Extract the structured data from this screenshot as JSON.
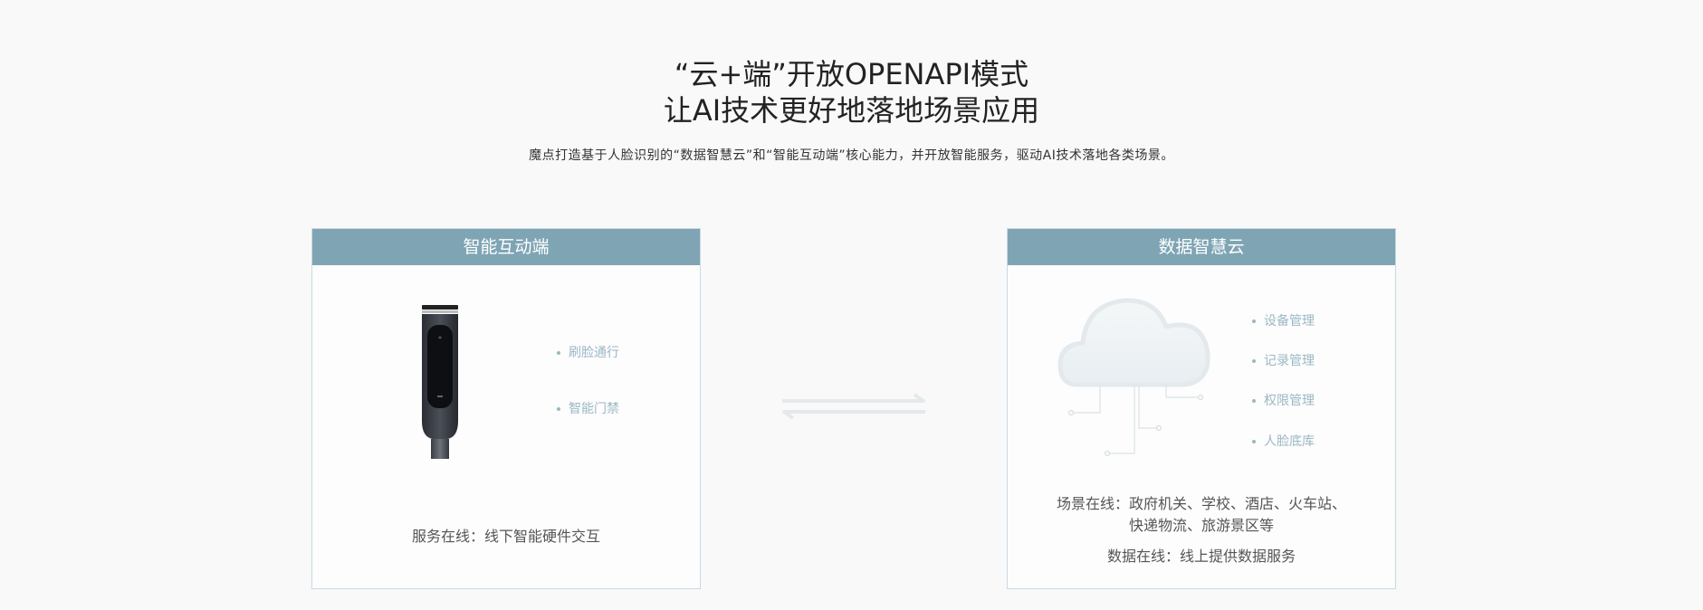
{
  "hero": {
    "title_line1": "“云+端”开放OPENAPI模式",
    "title_line2": "让AI技术更好地落地场景应用",
    "subtitle": "魔点打造基于人脸识别的“数据智慧云”和“智能互动端”核心能力，并开放智能服务，驱动AI技术落地各类场景。"
  },
  "left_panel": {
    "title": "智能互动端",
    "features": [
      "刷脸通行",
      "智能门禁"
    ],
    "caption": "服务在线：线下智能硬件交互"
  },
  "right_panel": {
    "title": "数据智慧云",
    "features": [
      "设备管理",
      "记录管理",
      "权限管理",
      "人脸底库"
    ],
    "caption_line1": "场景在线：政府机关、学校、酒店、火车站、",
    "caption_line2": "快递物流、旅游景区等",
    "caption2": "数据在线：线上提供数据服务"
  },
  "icons": {
    "device": "face-recognition-device-icon",
    "cloud": "cloud-icon",
    "arrows": "bidirectional-arrows-icon"
  },
  "colors": {
    "header_bg": "#7fa5b5",
    "feature_text": "#9ab8c4",
    "panel_border": "#c9dbe3"
  }
}
